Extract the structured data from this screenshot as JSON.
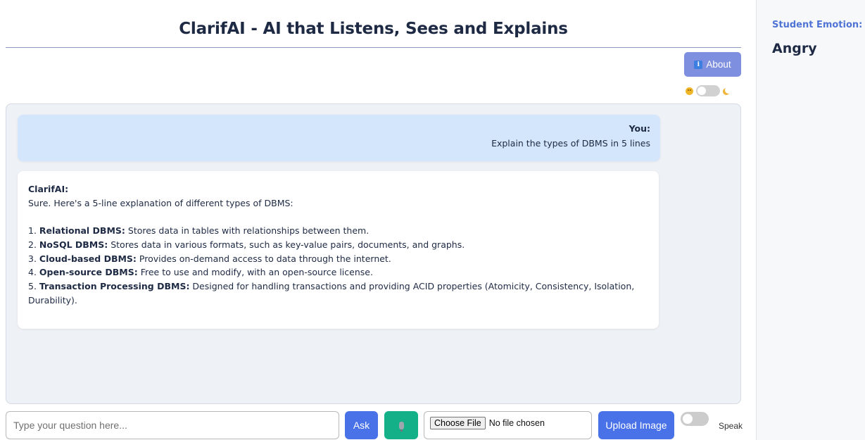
{
  "header": {
    "title": "ClarifAI - AI that Listens, Sees and Explains",
    "about_label": "About"
  },
  "theme": {
    "light_icon": "sun-icon",
    "dark_icon": "moon-icon",
    "dark_mode_on": false
  },
  "chat": {
    "user_message": {
      "sender": "You:",
      "text": "Explain the types of DBMS in 5 lines"
    },
    "bot_message": {
      "sender": "ClarifAI:",
      "intro": "Sure. Here's a 5-line explanation of different types of DBMS:",
      "items": [
        {
          "num": "1. ",
          "term": "Relational DBMS:",
          "desc": " Stores data in tables with relationships between them."
        },
        {
          "num": "2. ",
          "term": "NoSQL DBMS:",
          "desc": " Stores data in various formats, such as key-value pairs, documents, and graphs."
        },
        {
          "num": "3. ",
          "term": "Cloud-based DBMS:",
          "desc": " Provides on-demand access to data through the internet."
        },
        {
          "num": "4. ",
          "term": "Open-source DBMS:",
          "desc": " Free to use and modify, with an open-source license."
        },
        {
          "num": "5. ",
          "term": "Transaction Processing DBMS:",
          "desc": " Designed for handling transactions and providing ACID properties (Atomicity, Consistency, Isolation, Durability)."
        }
      ]
    }
  },
  "input_bar": {
    "question_placeholder": "Type your question here...",
    "ask_label": "Ask",
    "mic_icon": "microphone-icon",
    "choose_file_label": "Choose File",
    "file_status": "No file chosen",
    "upload_label": "Upload Image",
    "speak_label": "Speak",
    "speak_on": false
  },
  "sidebar": {
    "emotion_label": "Student Emotion:",
    "emotion_value": "Angry"
  },
  "colors": {
    "primary_button": "#4a72e8",
    "mic_button": "#14b088",
    "about_button": "#7f8fe0",
    "user_bubble": "#d3e6fb",
    "chat_panel": "#eef1f6",
    "emotion_label": "#4f74d6",
    "heading_text": "#1e2a44"
  }
}
